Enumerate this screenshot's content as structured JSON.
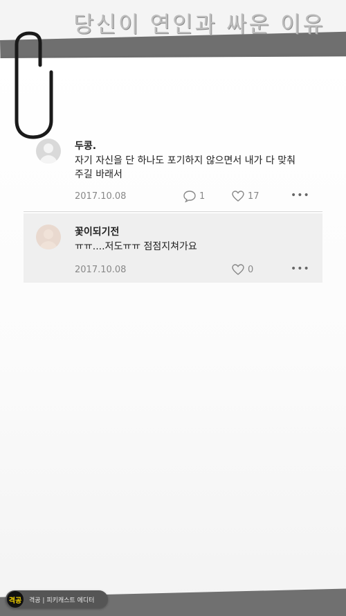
{
  "title": "당신이 연인과 싸운 이유",
  "comments": [
    {
      "nickname": "두콩.",
      "text": "자기 자신을 단 하나도 포기하지 않으면서 내가 다 맞춰주길 바래서",
      "date": "2017.10.08",
      "reply_count": "1",
      "like_count": "17",
      "more": "•••"
    },
    {
      "nickname": "꽃이되기전",
      "text": "ㅠㅠ....저도ㅠㅠ 점점지쳐가요",
      "date": "2017.10.08",
      "like_count": "0",
      "more": "•••"
    }
  ],
  "footer": {
    "badge": "격공",
    "text": "격공 | 피키캐스트 에디터"
  },
  "colors": {
    "tape": "#6f6f6f",
    "badge_text": "#f5d300",
    "meta_text": "#888888"
  }
}
